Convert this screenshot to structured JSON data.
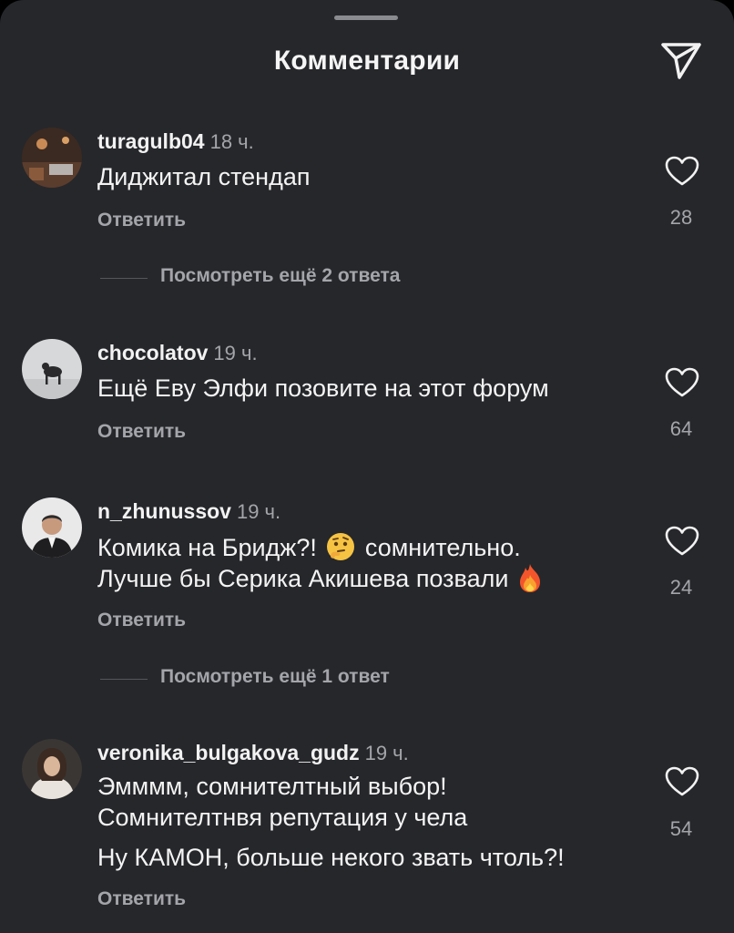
{
  "header": {
    "title": "Комментарии"
  },
  "comments": [
    {
      "username": "turagulb04",
      "time": "18 ч.",
      "lines": [
        "Диджитал стендап"
      ],
      "reply_label": "Ответить",
      "likes": "28",
      "more_replies": "Посмотреть ещё 2 ответа"
    },
    {
      "username": "chocolatov",
      "time": "19 ч.",
      "lines": [
        "Ещё Еву Элфи позовите на этот форум"
      ],
      "reply_label": "Ответить",
      "likes": "64"
    },
    {
      "username": "n_zhunussov",
      "time": "19 ч.",
      "line1_a": "Комика на Бридж?!",
      "line1_b": "сомнительно.",
      "line2": "Лучше бы Серика Акишева позвали",
      "reply_label": "Ответить",
      "likes": "24",
      "more_replies": "Посмотреть ещё 1 ответ"
    },
    {
      "username": "veronika_bulgakova_gudz",
      "time": "19 ч.",
      "lines": [
        "Эмммм, сомнителтный выбор!",
        "Сомнителтнвя репутация у чела",
        "Ну КАМОН, больше некого звать чтоль?!"
      ],
      "reply_label": "Ответить",
      "likes": "54"
    }
  ],
  "icons": {
    "send": "send-icon",
    "heart": "heart-icon",
    "thinking": "thinking-face-emoji",
    "fire": "fire-emoji"
  },
  "colors": {
    "background": "#26272b",
    "text": "#f4f4f4",
    "secondary": "#a4a5aa"
  }
}
